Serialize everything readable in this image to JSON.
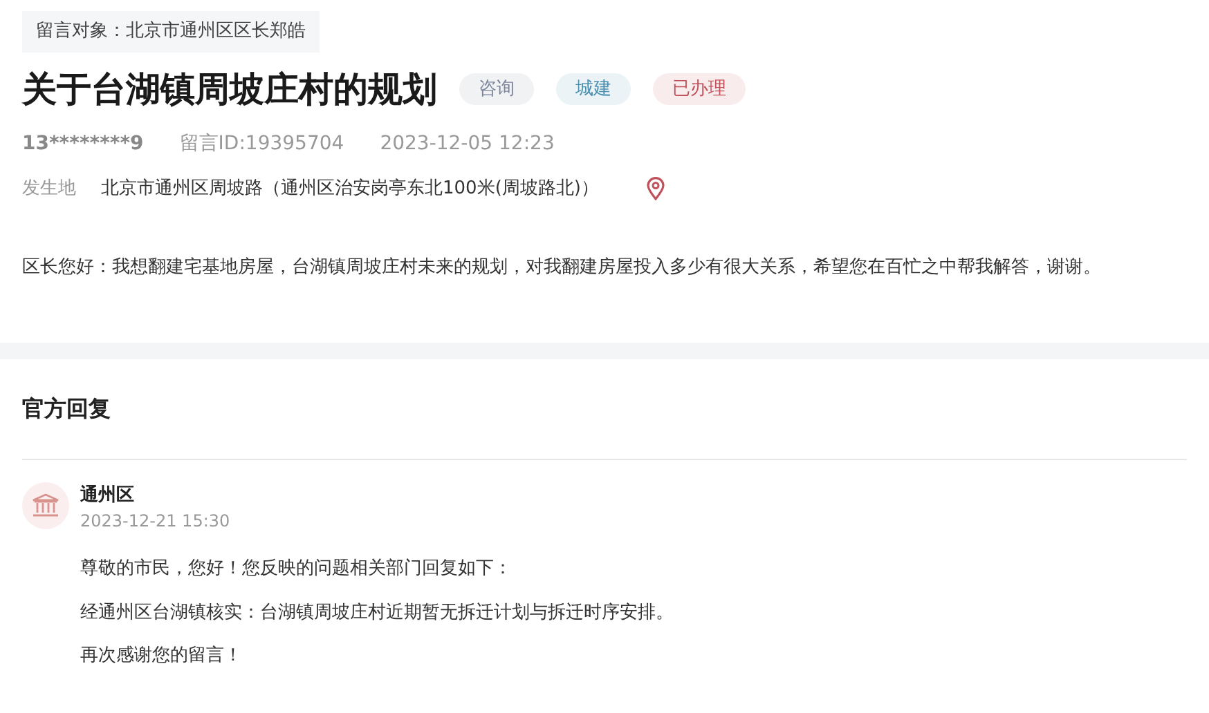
{
  "target": {
    "label": "留言对象：北京市通州区区长郑皓"
  },
  "title": "关于台湖镇周坡庄村的规划",
  "tags": [
    {
      "label": "咨询",
      "color": "#7a8599"
    },
    {
      "label": "城建",
      "color": "#4a8fb0"
    },
    {
      "label": "已办理",
      "color": "#c0505a"
    }
  ],
  "meta": {
    "user": "13********9",
    "message_id": "留言ID:19395704",
    "time": "2023-12-05 12:23"
  },
  "location": {
    "label": "发生地",
    "address": "北京市通州区周坡路（通州区治安岗亭东北100米(周坡路北)）"
  },
  "message": "区长您好：我想翻建宅基地房屋，台湖镇周坡庄村未来的规划，对我翻建房屋投入多少有很大关系，希望您在百忙之中帮我解答，谢谢。",
  "reply_section": {
    "heading": "官方回复"
  },
  "reply": {
    "author": "通州区",
    "time": "2023-12-21 15:30",
    "paragraphs": [
      "尊敬的市民，您好！您反映的问题相关部门回复如下：",
      "经通州区台湖镇核实：台湖镇周坡庄村近期暂无拆迁计划与拆迁时序安排。",
      "再次感谢您的留言！"
    ]
  }
}
